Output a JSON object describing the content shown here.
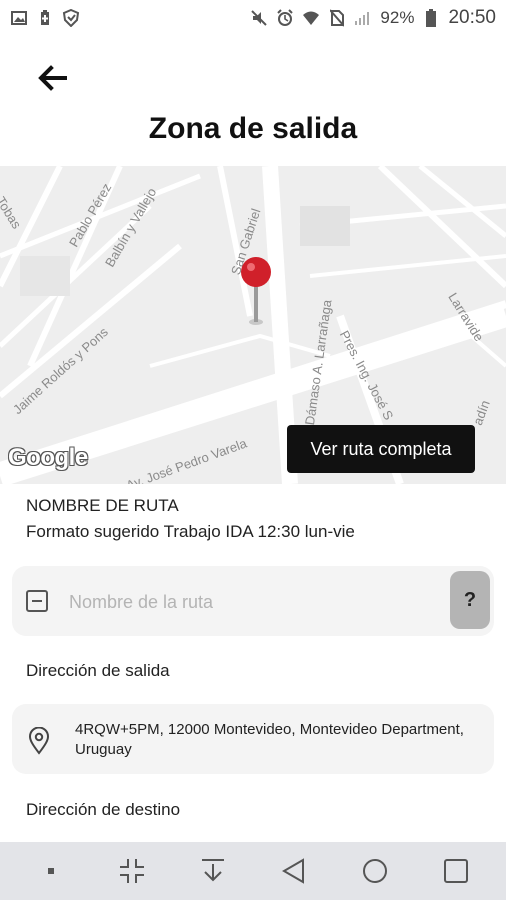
{
  "status_bar": {
    "battery_percent": "92%",
    "time": "20:50",
    "left_icons": [
      "image-icon",
      "battery-saver-icon",
      "shield-icon"
    ],
    "right_icons": [
      "mute-icon",
      "alarm-icon",
      "wifi-icon",
      "no-sim-icon",
      "signal-icon",
      "battery-icon"
    ]
  },
  "header": {
    "back_icon": "arrow-left-icon",
    "title": "Zona de salida"
  },
  "map": {
    "streets": [
      "Tobas",
      "Pablo Pérez",
      "Balbín y Vallejo",
      "San Gabriel",
      "Jaime Roldós y Pons",
      "Av. José Pedro Varela",
      "Dámaso A. Larrañaga",
      "Pres. Ing. José S",
      "Larravide",
      "adín"
    ],
    "logo": "Google",
    "button_label": "Ver ruta completa",
    "pin_color": "#d0202a"
  },
  "route_name": {
    "label": "NOMBRE DE RUTA",
    "hint": "Formato sugerido  Trabajo IDA 12:30 lun-vie",
    "input_value": "",
    "input_placeholder": "Nombre de la ruta",
    "help_label": "?"
  },
  "departure": {
    "label": "Dirección de salida",
    "address": "4RQW+5PM, 12000 Montevideo, Montevideo Department, Uruguay"
  },
  "destination": {
    "label": "Dirección de destino"
  },
  "nav_bar": {
    "buttons": [
      "dot-icon",
      "collapse-icon",
      "download-icon",
      "back-triangle-icon",
      "home-circle-icon",
      "recents-square-icon"
    ]
  }
}
